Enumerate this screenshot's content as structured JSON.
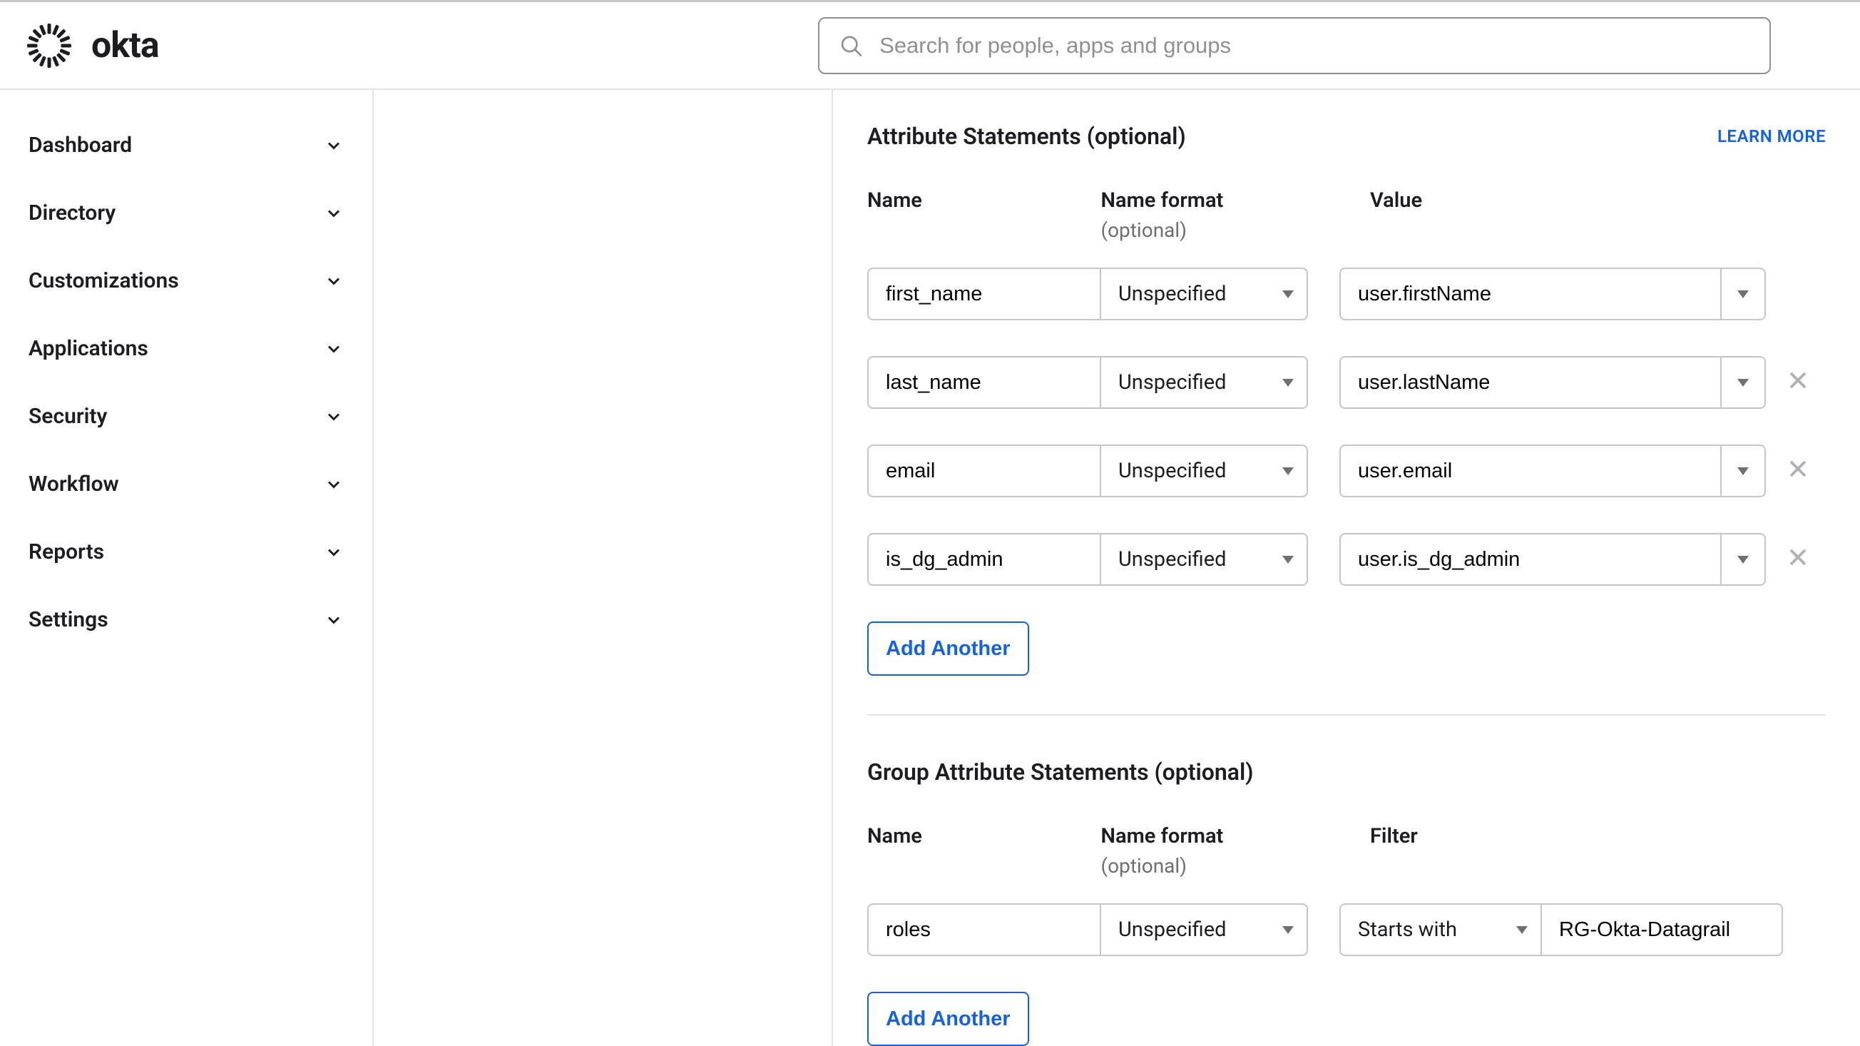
{
  "search": {
    "placeholder": "Search for people, apps and groups"
  },
  "brand": {
    "wordmark": "okta"
  },
  "sidebar": {
    "items": [
      {
        "label": "Dashboard"
      },
      {
        "label": "Directory"
      },
      {
        "label": "Customizations"
      },
      {
        "label": "Applications"
      },
      {
        "label": "Security"
      },
      {
        "label": "Workflow"
      },
      {
        "label": "Reports"
      },
      {
        "label": "Settings"
      }
    ]
  },
  "attr": {
    "title": "Attribute Statements (optional)",
    "learn_more": "LEARN MORE",
    "headers": {
      "name": "Name",
      "format": "Name format",
      "format_opt": "(optional)",
      "value": "Value"
    },
    "rows": [
      {
        "name": "first_name",
        "format": "Unspecified",
        "value": "user.firstName",
        "removable": false
      },
      {
        "name": "last_name",
        "format": "Unspecified",
        "value": "user.lastName",
        "removable": true
      },
      {
        "name": "email",
        "format": "Unspecified",
        "value": "user.email",
        "removable": true
      },
      {
        "name": "is_dg_admin",
        "format": "Unspecified",
        "value": "user.is_dg_admin",
        "removable": true
      }
    ],
    "add_label": "Add Another"
  },
  "group": {
    "title": "Group Attribute Statements (optional)",
    "headers": {
      "name": "Name",
      "format": "Name format",
      "format_opt": "(optional)",
      "filter": "Filter"
    },
    "rows": [
      {
        "name": "roles",
        "format": "Unspecified",
        "filter_op": "Starts with",
        "filter_val": "RG-Okta-Datagrail"
      }
    ],
    "add_label": "Add Another"
  }
}
